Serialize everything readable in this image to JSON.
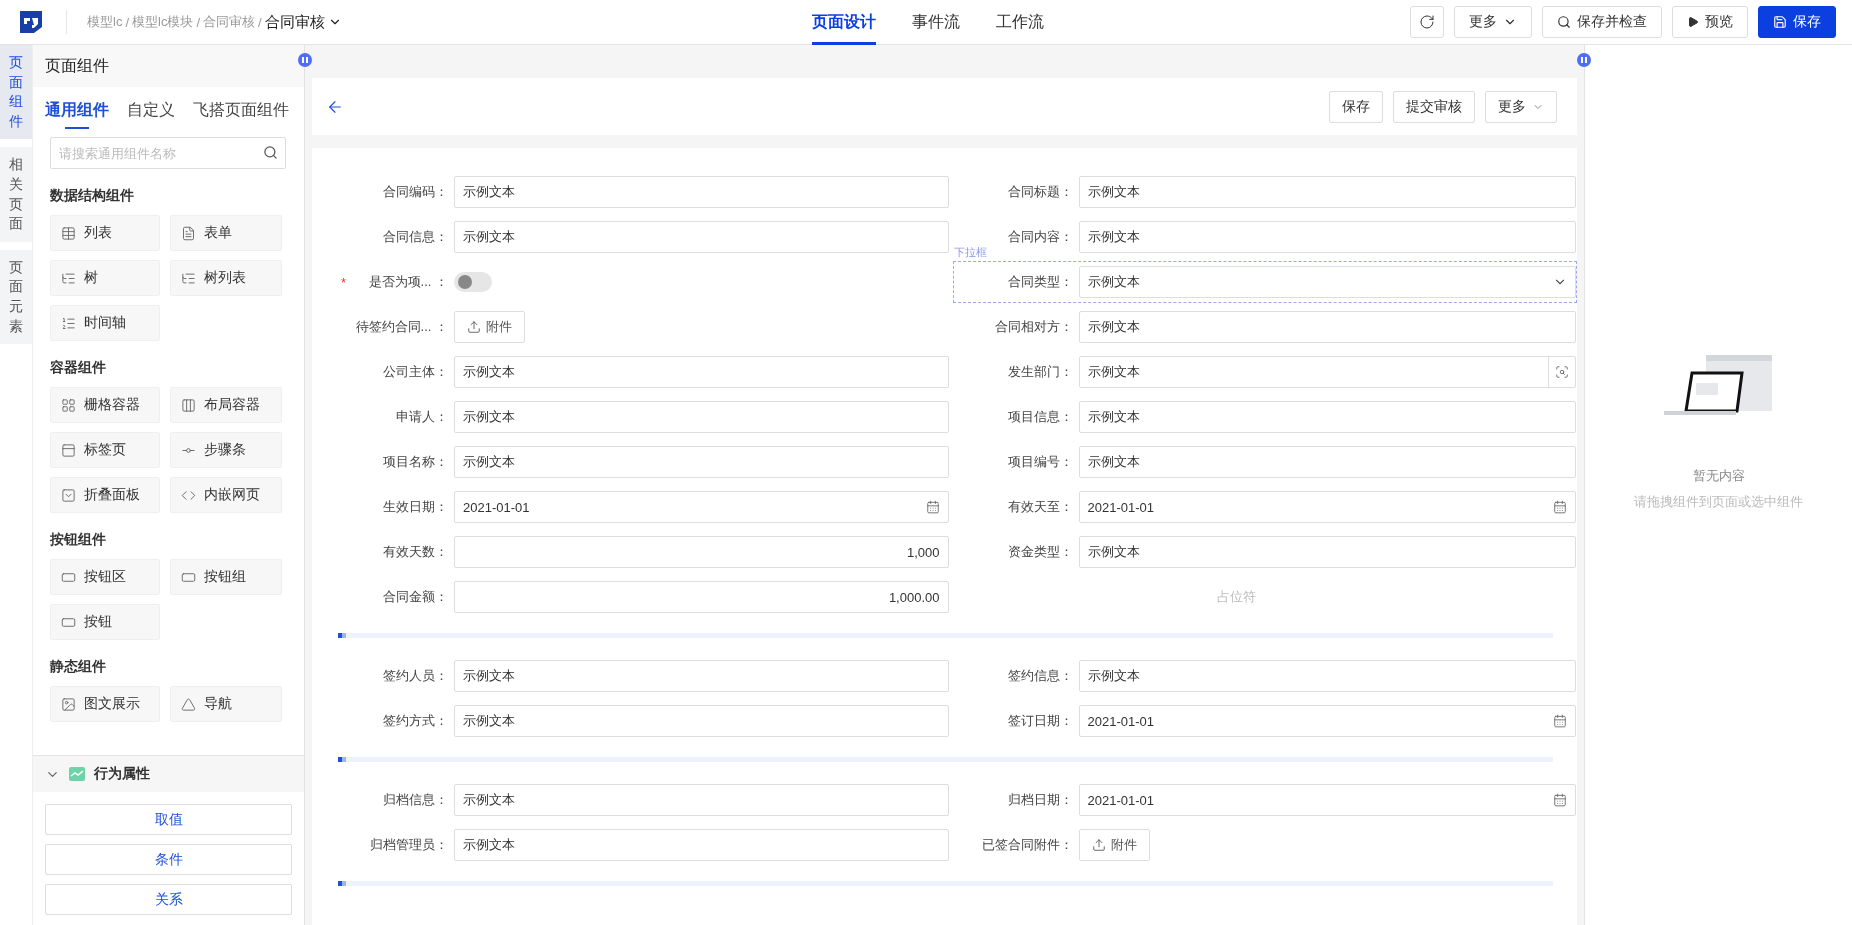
{
  "topbar": {
    "breadcrumb": [
      {
        "kind": "link",
        "text": "模型lc"
      },
      {
        "kind": "separator",
        "text": "/"
      },
      {
        "kind": "link",
        "text": "模型lc模块"
      },
      {
        "kind": "separator",
        "text": "/"
      },
      {
        "kind": "link",
        "text": "合同审核"
      },
      {
        "kind": "separator",
        "text": "/"
      },
      {
        "kind": "current",
        "text": "合同审核"
      }
    ],
    "tabs": [
      {
        "label": "页面设计",
        "selected": true
      },
      {
        "label": "事件流",
        "selected": false
      },
      {
        "label": "工作流",
        "selected": false
      }
    ],
    "actions": [
      {
        "kind": "refresh"
      },
      {
        "kind": "more",
        "label": "更多"
      },
      {
        "kind": "check",
        "label": "保存并检查"
      },
      {
        "kind": "preview",
        "label": "预览"
      },
      {
        "kind": "primary",
        "label": "保存"
      }
    ]
  },
  "rail": [
    {
      "label": "页面组件",
      "selected": true
    },
    {
      "label": "相关页面",
      "selected": false
    },
    {
      "label": "页面元素",
      "selected": false
    }
  ],
  "left_panel": {
    "title": "页面组件",
    "tabs": [
      {
        "label": "通用组件",
        "selected": true
      },
      {
        "label": "自定义",
        "selected": false
      },
      {
        "label": "飞搭页面组件",
        "selected": false
      }
    ],
    "search": {
      "placeholder": "请搜索通用组件名称"
    },
    "groups": [
      {
        "title": "数据结构组件",
        "items": [
          {
            "label": "列表",
            "kind": "table"
          },
          {
            "label": "表单",
            "kind": "form"
          },
          {
            "label": "树",
            "kind": "tree"
          },
          {
            "label": "树列表",
            "kind": "treelist"
          },
          {
            "label": "时间轴",
            "kind": "timeline"
          }
        ]
      },
      {
        "title": "容器组件",
        "items": [
          {
            "label": "栅格容器",
            "kind": "grid"
          },
          {
            "label": "布局容器",
            "kind": "columns"
          },
          {
            "label": "标签页",
            "kind": "tab"
          },
          {
            "label": "步骤条",
            "kind": "steps"
          },
          {
            "label": "折叠面板",
            "kind": "collapse"
          },
          {
            "label": "内嵌网页",
            "kind": "code"
          }
        ]
      },
      {
        "title": "按钮组件",
        "items": [
          {
            "label": "按钮区",
            "kind": "buttonarea"
          },
          {
            "label": "按钮组",
            "kind": "buttongroup"
          },
          {
            "label": "按钮",
            "kind": "button"
          }
        ]
      },
      {
        "title": "静态组件",
        "items": [
          {
            "label": "图文展示",
            "kind": "image"
          },
          {
            "label": "导航",
            "kind": "nav"
          }
        ]
      }
    ],
    "behavior": {
      "title": "行为属性",
      "expanded": true,
      "buttons": [
        "取值",
        "条件",
        "关系"
      ]
    }
  },
  "canvas": {
    "header_buttons": [
      {
        "label": "保存",
        "caret": false
      },
      {
        "label": "提交审核",
        "caret": false
      },
      {
        "label": "更多",
        "caret": true
      }
    ],
    "sections": [
      {
        "fields": [
          {
            "label": "合同编码：",
            "kind": "text",
            "value": "示例文本",
            "selected": false
          },
          {
            "label": "合同标题：",
            "kind": "text",
            "value": "示例文本",
            "selected": false
          },
          {
            "label": "合同信息：",
            "kind": "text",
            "value": "示例文本",
            "selected": false
          },
          {
            "label": "合同内容：",
            "kind": "text",
            "value": "示例文本",
            "selected": false
          },
          {
            "label": "是否为项...  ：",
            "kind": "switch",
            "required_mark": "*",
            "on": false,
            "selected": false
          },
          {
            "label": "合同类型：",
            "kind": "select",
            "value": "示例文本",
            "selected": true,
            "tag": "下拉框"
          },
          {
            "label": "待签约合同...  ：",
            "kind": "upload",
            "value": "附件",
            "selected": false
          },
          {
            "label": "合同相对方：",
            "kind": "text",
            "value": "示例文本",
            "selected": false
          },
          {
            "label": "公司主体：",
            "kind": "text",
            "value": "示例文本",
            "selected": false
          },
          {
            "label": "发生部门：",
            "kind": "lookup",
            "value": "示例文本",
            "selected": false
          },
          {
            "label": "申请人：",
            "kind": "text",
            "value": "示例文本",
            "selected": false
          },
          {
            "label": "项目信息：",
            "kind": "text",
            "value": "示例文本",
            "selected": false
          },
          {
            "label": "项目名称：",
            "kind": "text",
            "value": "示例文本",
            "selected": false
          },
          {
            "label": "项目编号：",
            "kind": "text",
            "value": "示例文本",
            "selected": false
          },
          {
            "label": "生效日期：",
            "kind": "date",
            "value": "2021-01-01",
            "selected": false
          },
          {
            "label": "有效天至：",
            "kind": "date",
            "value": "2021-01-01",
            "selected": false
          },
          {
            "label": "有效天数：",
            "kind": "number",
            "value": "1,000",
            "selected": false
          },
          {
            "label": "资金类型：",
            "kind": "text",
            "value": "示例文本",
            "selected": false
          },
          {
            "label": "合同金额：",
            "kind": "number",
            "value": "1,000.00",
            "selected": false
          },
          {
            "label": "占位符",
            "kind": "placeholder",
            "selected": false
          }
        ]
      },
      {
        "fields": [
          {
            "label": "签约人员：",
            "kind": "text",
            "value": "示例文本",
            "selected": false
          },
          {
            "label": "签约信息：",
            "kind": "text",
            "value": "示例文本",
            "selected": false
          },
          {
            "label": "签约方式：",
            "kind": "text",
            "value": "示例文本",
            "selected": false
          },
          {
            "label": "签订日期：",
            "kind": "date",
            "value": "2021-01-01",
            "selected": false
          }
        ]
      },
      {
        "fields": [
          {
            "label": "归档信息：",
            "kind": "text",
            "value": "示例文本",
            "selected": false
          },
          {
            "label": "归档日期：",
            "kind": "date",
            "value": "2021-01-01",
            "selected": false
          },
          {
            "label": "归档管理员：",
            "kind": "text",
            "value": "示例文本",
            "selected": false
          },
          {
            "label": "已签合同附件：",
            "kind": "upload",
            "value": "附件",
            "selected": false
          }
        ]
      }
    ]
  },
  "right_panel": {
    "empty_title": "暂无内容",
    "empty_hint": "请拖拽组件到页面或选中组件"
  }
}
